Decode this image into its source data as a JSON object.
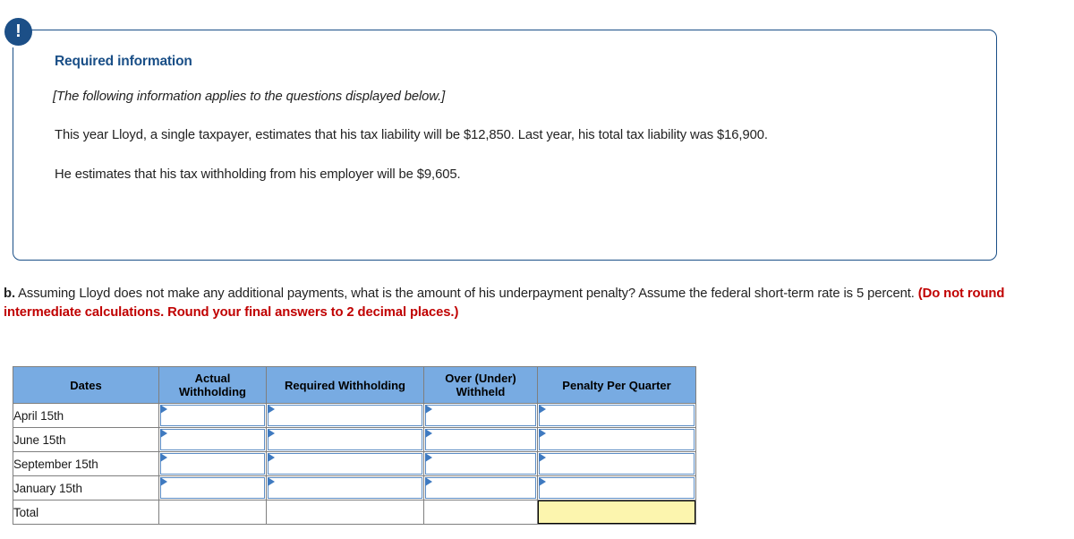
{
  "callout": {
    "icon": "exclamation-icon",
    "title": "Required information",
    "applies_note": "[The following information applies to the questions displayed below.]",
    "fact_line_1": "This year Lloyd, a single taxpayer, estimates that his tax liability will be $12,850. Last year, his total tax liability was $16,900.",
    "fact_line_2": "He estimates that his tax withholding from his employer will be $9,605.",
    "border_color": "#1a4f87",
    "title_color": "#1a4f87"
  },
  "question": {
    "label": "b.",
    "text": " Assuming Lloyd does not make any additional payments, what is the amount of his underpayment penalty? Assume the federal short-term rate is 5 percent. ",
    "instruction": "(Do not round intermediate calculations. Round your final answers to 2 decimal places.)",
    "instruction_color": "#c00000"
  },
  "table": {
    "headers": [
      "Dates",
      "Actual Withholding",
      "Required Withholding",
      "Over (Under) Withheld",
      "Penalty Per Quarter"
    ],
    "header_bg": "#78ABE2",
    "rows": [
      {
        "label": "April 15th",
        "cells": [
          "input",
          "input",
          "input",
          "input"
        ]
      },
      {
        "label": "June 15th",
        "cells": [
          "input",
          "input",
          "input",
          "input"
        ]
      },
      {
        "label": "September 15th",
        "cells": [
          "input",
          "input",
          "input",
          "input"
        ]
      },
      {
        "label": "January 15th",
        "cells": [
          "input",
          "input",
          "input",
          "input"
        ]
      },
      {
        "label": "Total",
        "cells": [
          "blank",
          "blank",
          "blank",
          "highlight"
        ]
      }
    ],
    "highlight_color": "#FCF5AE",
    "input_border_color": "#5b8cc4",
    "flag_color": "#3f7ac0"
  }
}
